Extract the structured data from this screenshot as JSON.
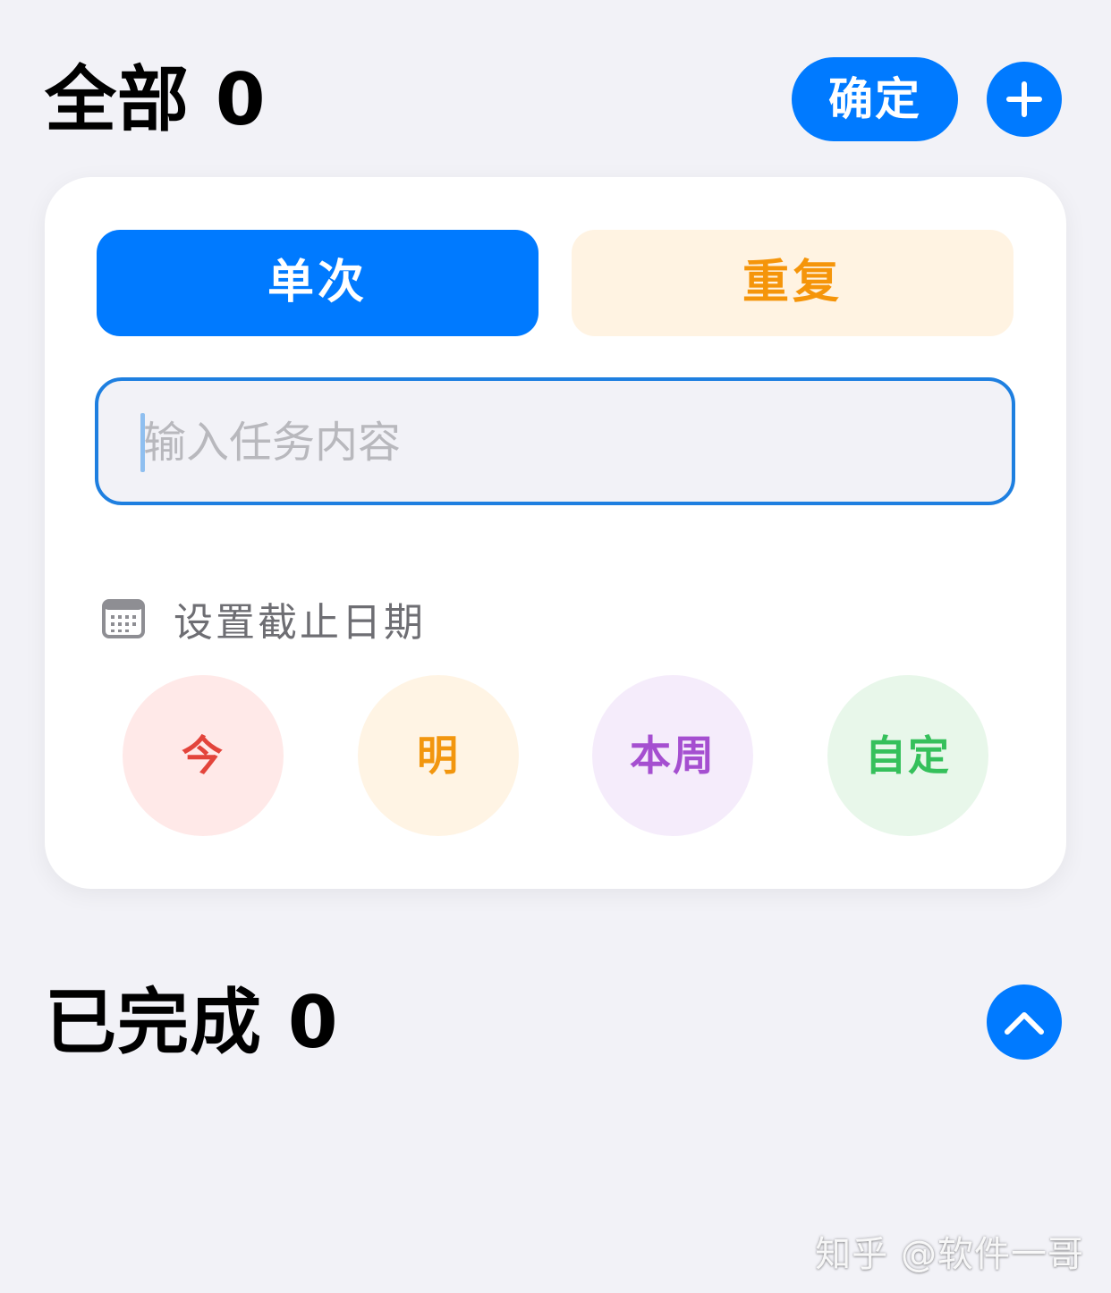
{
  "header": {
    "title": "全部 0",
    "confirm_label": "确定",
    "add_icon": "plus-icon"
  },
  "card": {
    "segments": {
      "single": "单次",
      "repeat": "重复",
      "selected": "单次"
    },
    "task_input": {
      "placeholder": "输入任务内容",
      "value": ""
    },
    "due": {
      "icon": "calendar-icon",
      "label": "设置截止日期"
    },
    "quick_dates": [
      {
        "label": "今",
        "color": "#e3443b",
        "bg": "#ffe9e8"
      },
      {
        "label": "明",
        "color": "#f2960e",
        "bg": "#fff4e4"
      },
      {
        "label": "本周",
        "color": "#a54fd0",
        "bg": "#f5ecfb"
      },
      {
        "label": "自定",
        "color": "#35c05b",
        "bg": "#e8f7ea"
      }
    ]
  },
  "completed": {
    "title": "已完成 0",
    "toggle_icon": "chevron-up-icon"
  },
  "watermark": "知乎 @软件一哥",
  "colors": {
    "accent": "#007aff",
    "background": "#f2f2f7",
    "card": "#ffffff",
    "repeat_text": "#f5950a",
    "repeat_bg": "#fff3e2"
  }
}
